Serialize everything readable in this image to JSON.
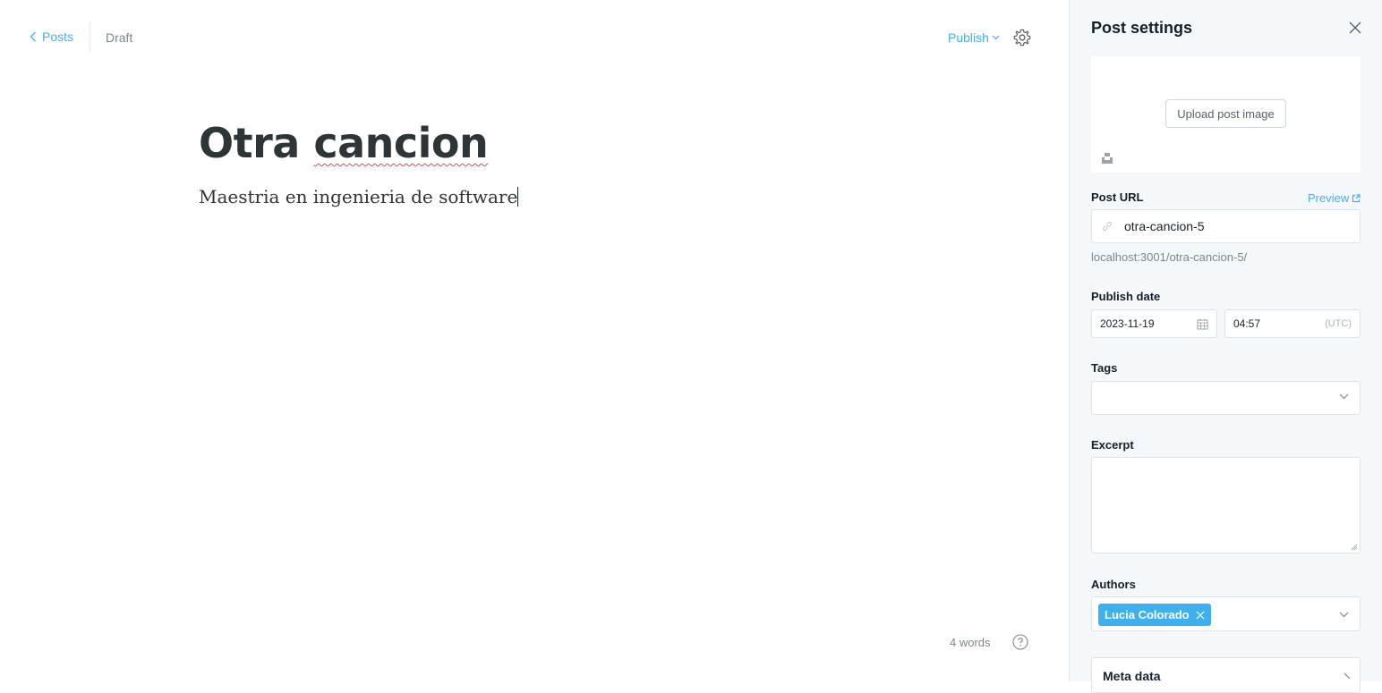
{
  "header": {
    "back_label": "Posts",
    "status": "Draft",
    "publish_label": "Publish"
  },
  "editor": {
    "title_word1": "Otra",
    "title_word2": "cancion",
    "body": "Maestria en ingenieria de software",
    "word_count": "4 words"
  },
  "settings": {
    "title": "Post settings",
    "upload_label": "Upload post image",
    "post_url_label": "Post URL",
    "preview_label": "Preview",
    "slug": "otra-cancion-5",
    "url_hint": "localhost:3001/otra-cancion-5/",
    "publish_date_label": "Publish date",
    "date": "2023-11-19",
    "time": "04:57",
    "timezone": "(UTC)",
    "tags_label": "Tags",
    "excerpt_label": "Excerpt",
    "authors_label": "Authors",
    "author_name": "Lucia Colorado",
    "meta_label": "Meta data"
  },
  "colors": {
    "accent": "#3eb0ef",
    "panel_bg": "#f4f8fb",
    "muted": "#7d878a"
  }
}
